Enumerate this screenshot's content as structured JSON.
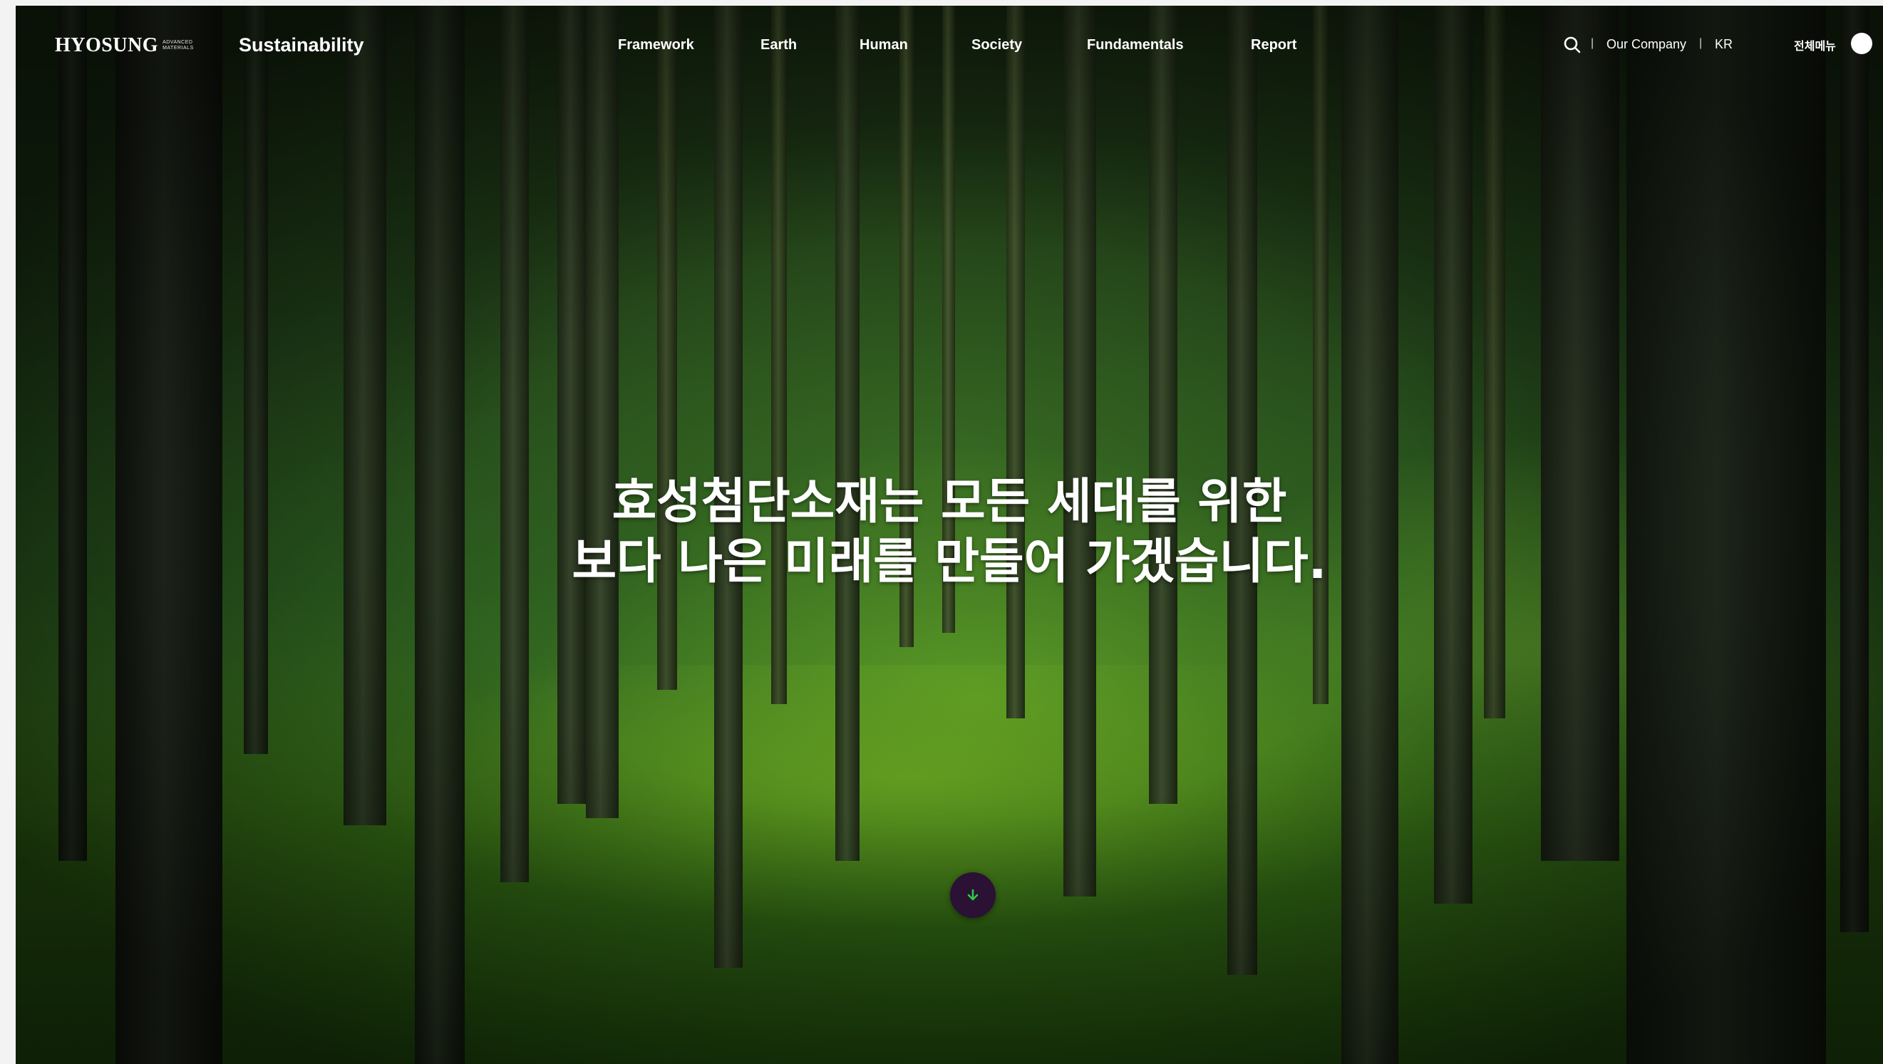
{
  "header": {
    "logo_text": "HYOSUNG",
    "logo_sub_line1": "ADVANCED",
    "logo_sub_line2": "MATERIALS",
    "brand_title": "Sustainability",
    "nav": [
      {
        "label": "Framework"
      },
      {
        "label": "Earth"
      },
      {
        "label": "Human"
      },
      {
        "label": "Society"
      },
      {
        "label": "Fundamentals"
      },
      {
        "label": "Report"
      }
    ],
    "utility": {
      "separator": "|",
      "company_label": "Our Company",
      "language_label": "KR",
      "all_menu_label": "전체메뉴"
    }
  },
  "hero": {
    "headline_line1": "효성첨단소재는 모든 세대를 위한",
    "headline_line2": "보다 나은 미래를 만들어 가겠습니다."
  },
  "colors": {
    "scroll_button": "#2b1133",
    "scroll_arrow": "#2ecc40"
  },
  "icons": {
    "search": "search-icon",
    "scroll": "arrow-down-icon",
    "menu": "menu-dot-icon"
  }
}
